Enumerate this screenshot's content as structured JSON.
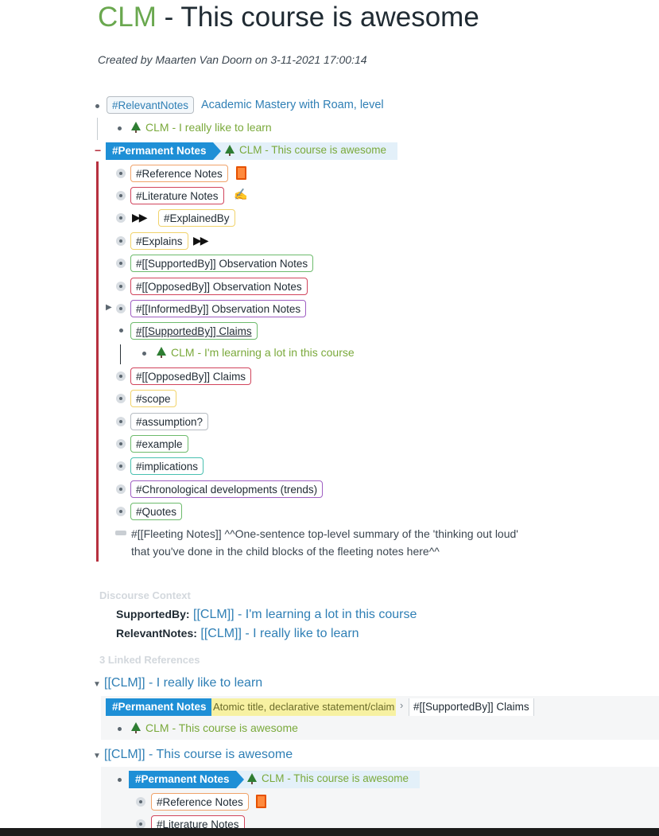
{
  "page": {
    "title_prefix": "CLM",
    "title_rest": " - This course is awesome",
    "created": "Created by Maarten Van Doorn on 3-11-2021 17:00:14"
  },
  "blocks": {
    "relevant_tag": "#RelevantNotes",
    "relevant_text": "Academic Mastery with Roam, level",
    "relevant_child": "CLM - I really like to learn",
    "permanent_tag": "#Permanent Notes",
    "permanent_text": "CLM - This course is awesome",
    "children": [
      {
        "label": "#Reference Notes",
        "icon": "book-icon"
      },
      {
        "label": "#Literature Notes",
        "icon": "writing-hand-icon"
      },
      {
        "label": "#ExplainedBy",
        "prefix": "▶▶"
      },
      {
        "label": "#Explains",
        "suffix": "▶▶"
      },
      {
        "label": "#[[SupportedBy]] Observation Notes"
      },
      {
        "label": "#[[OpposedBy]] Observation Notes"
      },
      {
        "label": "#[[InformedBy]] Observation Notes"
      },
      {
        "label": "#[[SupportedBy]] Claims"
      },
      {
        "label": "#[[OpposedBy]] Claims"
      },
      {
        "label": "#scope"
      },
      {
        "label": "#assumption?"
      },
      {
        "label": "#example"
      },
      {
        "label": "#implications"
      },
      {
        "label": "#Chronological developments (trends)"
      },
      {
        "label": "#Quotes"
      }
    ],
    "supported_child": "CLM - I'm learning a lot in this course",
    "fleeting_line1": "#[[Fleeting Notes]] ^^One-sentence top-level summary of the 'thinking out loud'",
    "fleeting_line2": "that you've done in the child blocks of the fleeting notes here^^"
  },
  "discourse": {
    "header": "Discourse Context",
    "supported_label": "SupportedBy:",
    "supported_value": "[[CLM]] - I'm learning a lot in this course",
    "relevant_label": "RelevantNotes:",
    "relevant_value": "[[CLM]] - I really like to learn"
  },
  "linked": {
    "header": "3 Linked References",
    "ref1_title": "[[CLM]] - I really like to learn",
    "ref1_bc_tag": "#Permanent Notes",
    "ref1_bc_highlight": "Atomic title, declarative statement/claim",
    "ref1_bc_sep": "›",
    "ref1_bc_last": "#[[SupportedBy]] Claims",
    "ref1_child": "CLM - This course is awesome",
    "ref2_title": "[[CLM]] - This course is awesome",
    "ref2_tag": "#Permanent Notes",
    "ref2_text": "CLM - This course is awesome",
    "ref2_child1": "#Reference Notes",
    "ref2_child2": "#Literature Notes"
  },
  "colors": {
    "accent_blue": "#1e8fd6",
    "link_green": "#7aa93b",
    "border_red": "#b7313f"
  }
}
